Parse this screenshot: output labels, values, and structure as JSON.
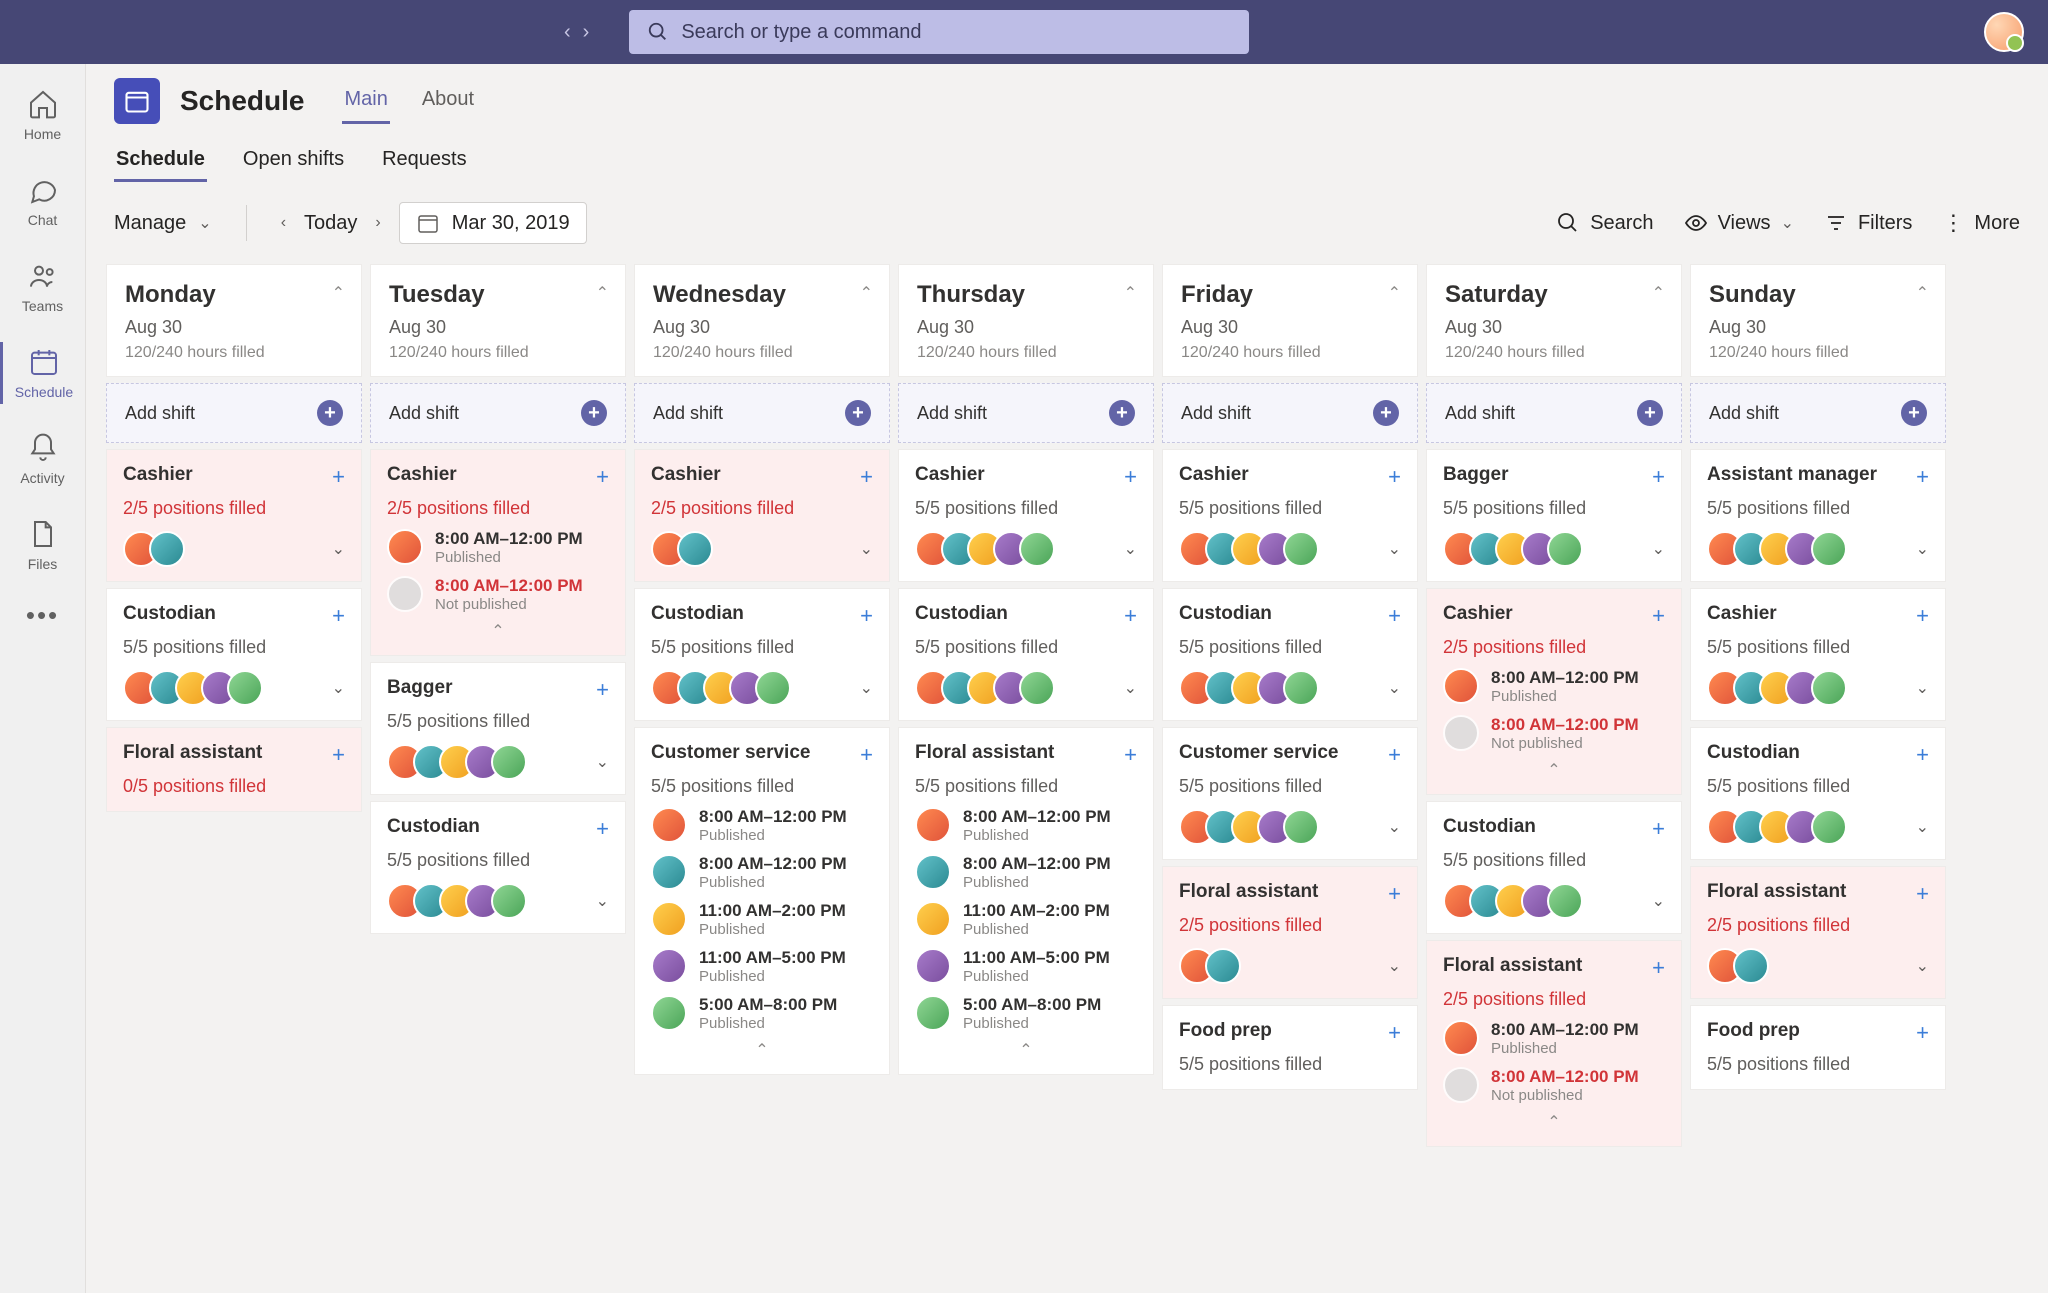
{
  "topbar": {
    "search_placeholder": "Search or type a command"
  },
  "rail": {
    "items": [
      {
        "label": "Home"
      },
      {
        "label": "Chat"
      },
      {
        "label": "Teams"
      },
      {
        "label": "Schedule"
      },
      {
        "label": "Activity"
      },
      {
        "label": "Files"
      }
    ]
  },
  "app": {
    "title": "Schedule",
    "tabs": [
      "Main",
      "About"
    ],
    "subtabs": [
      "Schedule",
      "Open shifts",
      "Requests"
    ],
    "manage_label": "Manage",
    "today_label": "Today",
    "date_label": "Mar 30, 2019",
    "toolbar": {
      "search": "Search",
      "views": "Views",
      "filters": "Filters",
      "more": "More"
    },
    "add_shift_label": "Add shift"
  },
  "week": [
    {
      "day": "Monday",
      "date": "Aug 30",
      "hours": "120/240 hours filled",
      "cards": [
        {
          "role": "Cashier",
          "status": "2/5 positions filled",
          "warn": true,
          "avatars": 2
        },
        {
          "role": "Custodian",
          "status": "5/5 positions filled",
          "warn": false,
          "avatars": 5
        },
        {
          "role": "Floral assistant",
          "status": "0/5 positions filled",
          "warn": true,
          "avatars": 0
        }
      ]
    },
    {
      "day": "Tuesday",
      "date": "Aug 30",
      "hours": "120/240 hours filled",
      "cards": [
        {
          "role": "Cashier",
          "status": "2/5 positions filled",
          "warn": true,
          "expanded": true,
          "shifts": [
            {
              "time": "8:00 AM–12:00 PM",
              "pub": "Published",
              "unpub": false
            },
            {
              "time": "8:00 AM–12:00 PM",
              "pub": "Not published",
              "unpub": true
            }
          ]
        },
        {
          "role": "Bagger",
          "status": "5/5 positions filled",
          "warn": false,
          "avatars": 5
        },
        {
          "role": "Custodian",
          "status": "5/5 positions filled",
          "warn": false,
          "avatars": 5
        }
      ]
    },
    {
      "day": "Wednesday",
      "date": "Aug 30",
      "hours": "120/240 hours filled",
      "cards": [
        {
          "role": "Cashier",
          "status": "2/5 positions filled",
          "warn": true,
          "avatars": 2
        },
        {
          "role": "Custodian",
          "status": "5/5 positions filled",
          "warn": false,
          "avatars": 5
        },
        {
          "role": "Customer service",
          "status": "5/5 positions filled",
          "warn": false,
          "expanded": true,
          "shifts": [
            {
              "time": "8:00 AM–12:00 PM",
              "pub": "Published"
            },
            {
              "time": "8:00 AM–12:00 PM",
              "pub": "Published"
            },
            {
              "time": "11:00 AM–2:00 PM",
              "pub": "Published"
            },
            {
              "time": "11:00 AM–5:00 PM",
              "pub": "Published"
            },
            {
              "time": "5:00 AM–8:00 PM",
              "pub": "Published"
            }
          ]
        }
      ]
    },
    {
      "day": "Thursday",
      "date": "Aug 30",
      "hours": "120/240 hours filled",
      "cards": [
        {
          "role": "Cashier",
          "status": "5/5 positions filled",
          "warn": false,
          "avatars": 5
        },
        {
          "role": "Custodian",
          "status": "5/5 positions filled",
          "warn": false,
          "avatars": 5
        },
        {
          "role": "Floral assistant",
          "status": "5/5 positions filled",
          "warn": false,
          "expanded": true,
          "shifts": [
            {
              "time": "8:00 AM–12:00 PM",
              "pub": "Published"
            },
            {
              "time": "8:00 AM–12:00 PM",
              "pub": "Published"
            },
            {
              "time": "11:00 AM–2:00 PM",
              "pub": "Published"
            },
            {
              "time": "11:00 AM–5:00 PM",
              "pub": "Published"
            },
            {
              "time": "5:00 AM–8:00 PM",
              "pub": "Published"
            }
          ]
        }
      ]
    },
    {
      "day": "Friday",
      "date": "Aug 30",
      "hours": "120/240 hours filled",
      "cards": [
        {
          "role": "Cashier",
          "status": "5/5 positions filled",
          "warn": false,
          "avatars": 5
        },
        {
          "role": "Custodian",
          "status": "5/5 positions filled",
          "warn": false,
          "avatars": 5
        },
        {
          "role": "Customer service",
          "status": "5/5 positions filled",
          "warn": false,
          "avatars": 5
        },
        {
          "role": "Floral assistant",
          "status": "2/5 positions filled",
          "warn": true,
          "avatars": 2
        },
        {
          "role": "Food prep",
          "status": "5/5 positions filled",
          "warn": false,
          "avatars": 0
        }
      ]
    },
    {
      "day": "Saturday",
      "date": "Aug 30",
      "hours": "120/240 hours filled",
      "cards": [
        {
          "role": "Bagger",
          "status": "5/5 positions filled",
          "warn": false,
          "avatars": 5
        },
        {
          "role": "Cashier",
          "status": "2/5 positions filled",
          "warn": true,
          "expanded": true,
          "shifts": [
            {
              "time": "8:00 AM–12:00 PM",
              "pub": "Published"
            },
            {
              "time": "8:00 AM–12:00 PM",
              "pub": "Not published",
              "unpub": true
            }
          ]
        },
        {
          "role": "Custodian",
          "status": "5/5 positions filled",
          "warn": false,
          "avatars": 5
        },
        {
          "role": "Floral assistant",
          "status": "2/5 positions filled",
          "warn": true,
          "shifts": [
            {
              "time": "8:00 AM–12:00 PM",
              "pub": "Published"
            },
            {
              "time": "8:00 AM–12:00 PM",
              "pub": "Not published",
              "unpub": true
            }
          ]
        }
      ]
    },
    {
      "day": "Sunday",
      "date": "Aug 30",
      "hours": "120/240 hours filled",
      "cards": [
        {
          "role": "Assistant manager",
          "status": "5/5 positions filled",
          "warn": false,
          "avatars": 5
        },
        {
          "role": "Cashier",
          "status": "5/5 positions filled",
          "warn": false,
          "avatars": 5
        },
        {
          "role": "Custodian",
          "status": "5/5 positions filled",
          "warn": false,
          "avatars": 5
        },
        {
          "role": "Floral assistant",
          "status": "2/5 positions filled",
          "warn": true,
          "avatars": 2
        },
        {
          "role": "Food prep",
          "status": "5/5 positions filled",
          "warn": false,
          "avatars": 0
        }
      ]
    }
  ]
}
